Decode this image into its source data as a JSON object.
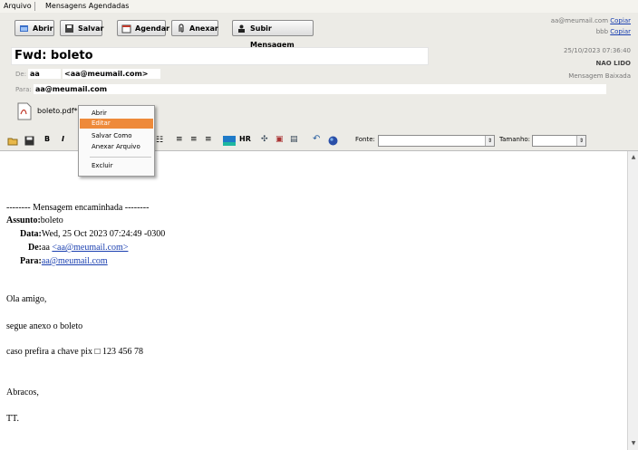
{
  "menu": {
    "arquivo": "Arquivo",
    "agendadas": "Mensagens Agendadas"
  },
  "toolbar": {
    "abrir": "Abrir",
    "salvar": "Salvar",
    "agendar": "Agendar",
    "anexar": "Anexar",
    "subir": "Subir Mensagem"
  },
  "email": {
    "subject": "Fwd: boleto",
    "de_label": "De:",
    "de_name": "aa",
    "de_email": "<aa@meumail.com>",
    "para_label": "Para:",
    "para_email": "aa@meumail.com"
  },
  "recipients": [
    {
      "email": "aa@meumail.com",
      "action": "Copiar"
    },
    {
      "email": "bbb",
      "action": "Copiar"
    }
  ],
  "meta": {
    "date": "25/10/2023 07:36:40",
    "status": "NAO LIDO",
    "status2": "Mensagem Baixada"
  },
  "attachment": {
    "name": "boleto.pdf*"
  },
  "context_menu": {
    "items": [
      "Abrir",
      "Editar",
      "Salvar Como",
      "Anexar Arquivo",
      "Excluir"
    ],
    "selected": "Editar"
  },
  "format": {
    "bold": "B",
    "italic": "I",
    "hr": "HR",
    "fonte_label": "Fonte:",
    "tamanho_label": "Tamanho:"
  },
  "body": {
    "fwd_header": "-------- Mensagem encaminhada --------",
    "assunto_label": "Assunto:",
    "assunto_value": "boleto",
    "data_label": "Data:",
    "data_value": "Wed, 25 Oct 2023 07:24:49 -0300",
    "de_label": "De:",
    "de_name": "aa ",
    "de_email": "<aa@meumail.com>",
    "para_label": "Para:",
    "para_email": "aa@meumail.com",
    "line1": "Ola amigo,",
    "line2": "segue anexo o boleto",
    "line3": "caso prefira a chave pix  □ 123 456 78",
    "line4": "Abracos,",
    "line5": "TT."
  }
}
